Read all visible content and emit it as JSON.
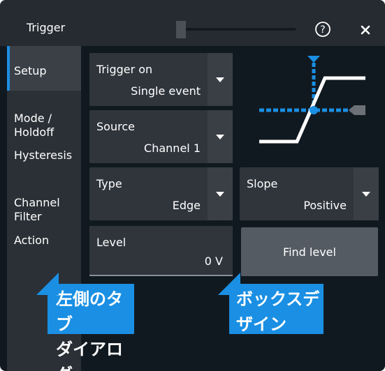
{
  "window": {
    "title": "Trigger"
  },
  "header": {
    "help_icon": "help-circle-icon",
    "close_icon": "close-icon"
  },
  "sidebar": {
    "items": [
      {
        "label": "Setup",
        "active": true
      },
      {
        "label": "Mode /\nHoldoff",
        "active": false
      },
      {
        "label": "Hysteresis",
        "active": false
      },
      {
        "label": "Channel\nFilter",
        "active": false
      },
      {
        "label": "Action",
        "active": false
      }
    ]
  },
  "fields": {
    "trigger_on": {
      "label": "Trigger on",
      "value": "Single event"
    },
    "source": {
      "label": "Source",
      "value": "Channel 1"
    },
    "type": {
      "label": "Type",
      "value": "Edge"
    },
    "slope": {
      "label": "Slope",
      "value": "Positive"
    },
    "level": {
      "label": "Level",
      "value": "0 V"
    }
  },
  "buttons": {
    "find_level": "Find level"
  },
  "annotations": {
    "left_callout": "左側のタブ\nダイアログ",
    "right_callout": "ボックスデ\nザイン"
  },
  "colors": {
    "accent": "#1a8fe3",
    "background": "#111920",
    "field": "#30353c",
    "sidebar": "#2b3036",
    "button": "#555b63"
  }
}
